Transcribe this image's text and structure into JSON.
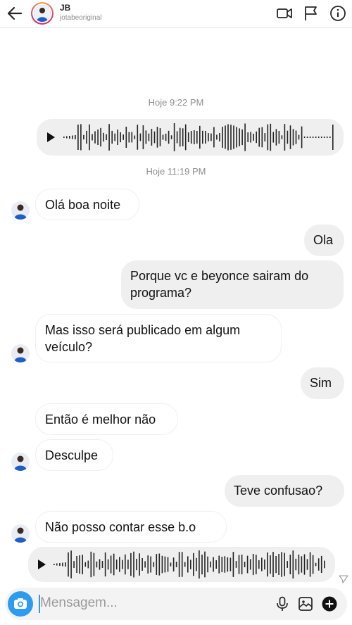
{
  "header": {
    "name": "JB",
    "username": "jotabeoriginal"
  },
  "timestamps": [
    "Hoje 9:22 PM",
    "Hoje 11:19 PM"
  ],
  "messages": {
    "m1": "Olá boa noite",
    "m2": "Ola",
    "m3": "Porque vc e beyonce sairam do programa?",
    "m4": "Mas isso será publicado em algum veículo?",
    "m5": "Sim",
    "m6": "Então é melhor não",
    "m7": "Desculpe",
    "m8": "Teve confusao?",
    "m9": "Não posso contar esse b.o"
  },
  "composer": {
    "placeholder": "Mensagem..."
  },
  "icons": {
    "header": [
      "back-arrow-icon",
      "video-call-icon",
      "flag-icon",
      "info-icon"
    ],
    "composer": [
      "camera-icon",
      "microphone-icon",
      "image-icon",
      "plus-circle-icon"
    ],
    "status": "seen-icon"
  },
  "colors": {
    "accent": "#2d9bf0",
    "bubble_out": "#efefef",
    "muted_text": "#8e8e8e"
  }
}
